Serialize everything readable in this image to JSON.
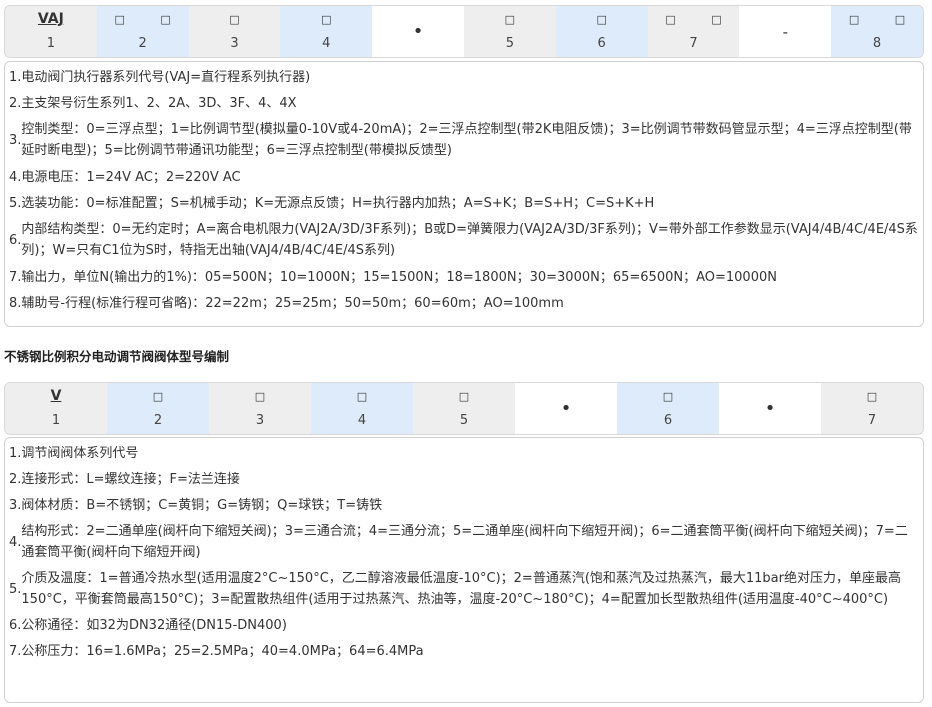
{
  "actuator_code": {
    "cells": [
      {
        "top": [
          "VAJ"
        ],
        "num": "1",
        "color": "gray",
        "strong": true
      },
      {
        "top": [
          "□",
          "□"
        ],
        "num": "2",
        "color": "blue"
      },
      {
        "top": [
          "□"
        ],
        "num": "3",
        "color": "gray"
      },
      {
        "top": [
          "□"
        ],
        "num": "4",
        "color": "blue"
      },
      {
        "sym": "•",
        "color": "white"
      },
      {
        "top": [
          "□"
        ],
        "num": "5",
        "color": "gray"
      },
      {
        "top": [
          "□"
        ],
        "num": "6",
        "color": "blue"
      },
      {
        "top": [
          "□",
          "□"
        ],
        "num": "7",
        "color": "gray"
      },
      {
        "sym": "-",
        "color": "white"
      },
      {
        "top": [
          "□",
          "□"
        ],
        "num": "8",
        "color": "blue"
      }
    ]
  },
  "actuator_desc": [
    {
      "no": "1.",
      "text": "电动阀门执行器系列代号(VAJ=直行程系列执行器)"
    },
    {
      "no": "2.",
      "text": "主支架号衍生系列1、2、2A、3D、3F、4、4X"
    },
    {
      "no": "3.",
      "text": "控制类型：0=三浮点型；1=比例调节型(模拟量0-10V或4-20mA)；2=三浮点控制型(带2K电阻反馈)；3=比例调节带数码管显示型；4=三浮点控制型(带延时断电型)；5=比例调节带通讯功能型；6=三浮点控制型(带模拟反馈型)"
    },
    {
      "no": "4.",
      "text": "电源电压：1=24V AC；2=220V AC"
    },
    {
      "no": "5.",
      "text": "选装功能：0=标准配置；S=机械手动；K=无源点反馈；H=执行器内加热；A=S+K；B=S+H；C=S+K+H"
    },
    {
      "no": "6.",
      "text": "内部结构类型：0=无约定时；A=离合电机限力(VAJ2A/3D/3F系列)；B或D=弹簧限力(VAJ2A/3D/3F系列)；V=带外部工作参数显示(VAJ4/4B/4C/4E/4S系列)；W=只有C1位为S时，特指无出轴(VAJ4/4B/4C/4E/4S系列)"
    },
    {
      "no": "7.",
      "text": "输出力，单位N(输出力的1%)：05=500N；10=1000N；15=1500N；18=1800N；30=3000N；65=6500N；AO=10000N"
    },
    {
      "no": "8.",
      "text": "辅助号-行程(标准行程可省略)：22=22m；25=25m；50=50m；60=60m；AO=100mm"
    }
  ],
  "section_title": "不锈钢比例积分电动调节阀阀体型号编制",
  "valve_code": {
    "cells": [
      {
        "top": [
          "V"
        ],
        "num": "1",
        "color": "gray",
        "strong": true
      },
      {
        "top": [
          "□"
        ],
        "num": "2",
        "color": "blue"
      },
      {
        "top": [
          "□"
        ],
        "num": "3",
        "color": "gray"
      },
      {
        "top": [
          "□"
        ],
        "num": "4",
        "color": "blue"
      },
      {
        "top": [
          "□"
        ],
        "num": "5",
        "color": "gray"
      },
      {
        "sym": "•",
        "color": "white"
      },
      {
        "top": [
          "□"
        ],
        "num": "6",
        "color": "blue"
      },
      {
        "sym": "•",
        "color": "white"
      },
      {
        "top": [
          "□"
        ],
        "num": "7",
        "color": "gray"
      }
    ]
  },
  "valve_desc": [
    {
      "no": "1.",
      "text": "调节阀阀体系列代号"
    },
    {
      "no": "2.",
      "text": "连接形式：L=螺纹连接；F=法兰连接"
    },
    {
      "no": "3.",
      "text": "阀体材质：B=不锈钢；C=黄铜；G=铸钢；Q=球铁；T=铸铁"
    },
    {
      "no": "4.",
      "text": "结构形式：2=二通单座(阀杆向下缩短关阀)；3=三通合流；4=三通分流；5=二通单座(阀杆向下缩短开阀)；6=二通套筒平衡(阀杆向下缩短关阀)；7=二通套筒平衡(阀杆向下缩短开阀)"
    },
    {
      "no": "5.",
      "text": "介质及温度：1=普通冷热水型(适用温度2°C~150°C，乙二醇溶液最低温度-10°C)；2=普通蒸汽(饱和蒸汽及过热蒸汽，最大11bar绝对压力，单座最高150°C，平衡套筒最高150°C)；3=配置散热组件(适用于过热蒸汽、热油等，温度-20°C~180°C)；4=配置加长型散热组件(适用温度-40°C~400°C)"
    },
    {
      "no": "6.",
      "text": "公称通径：如32为DN32通径(DN15-DN400)"
    },
    {
      "no": "7.",
      "text": "公称压力：16=1.6MPa；25=2.5MPa；40=4.0MPa；64=6.4MPa"
    }
  ]
}
